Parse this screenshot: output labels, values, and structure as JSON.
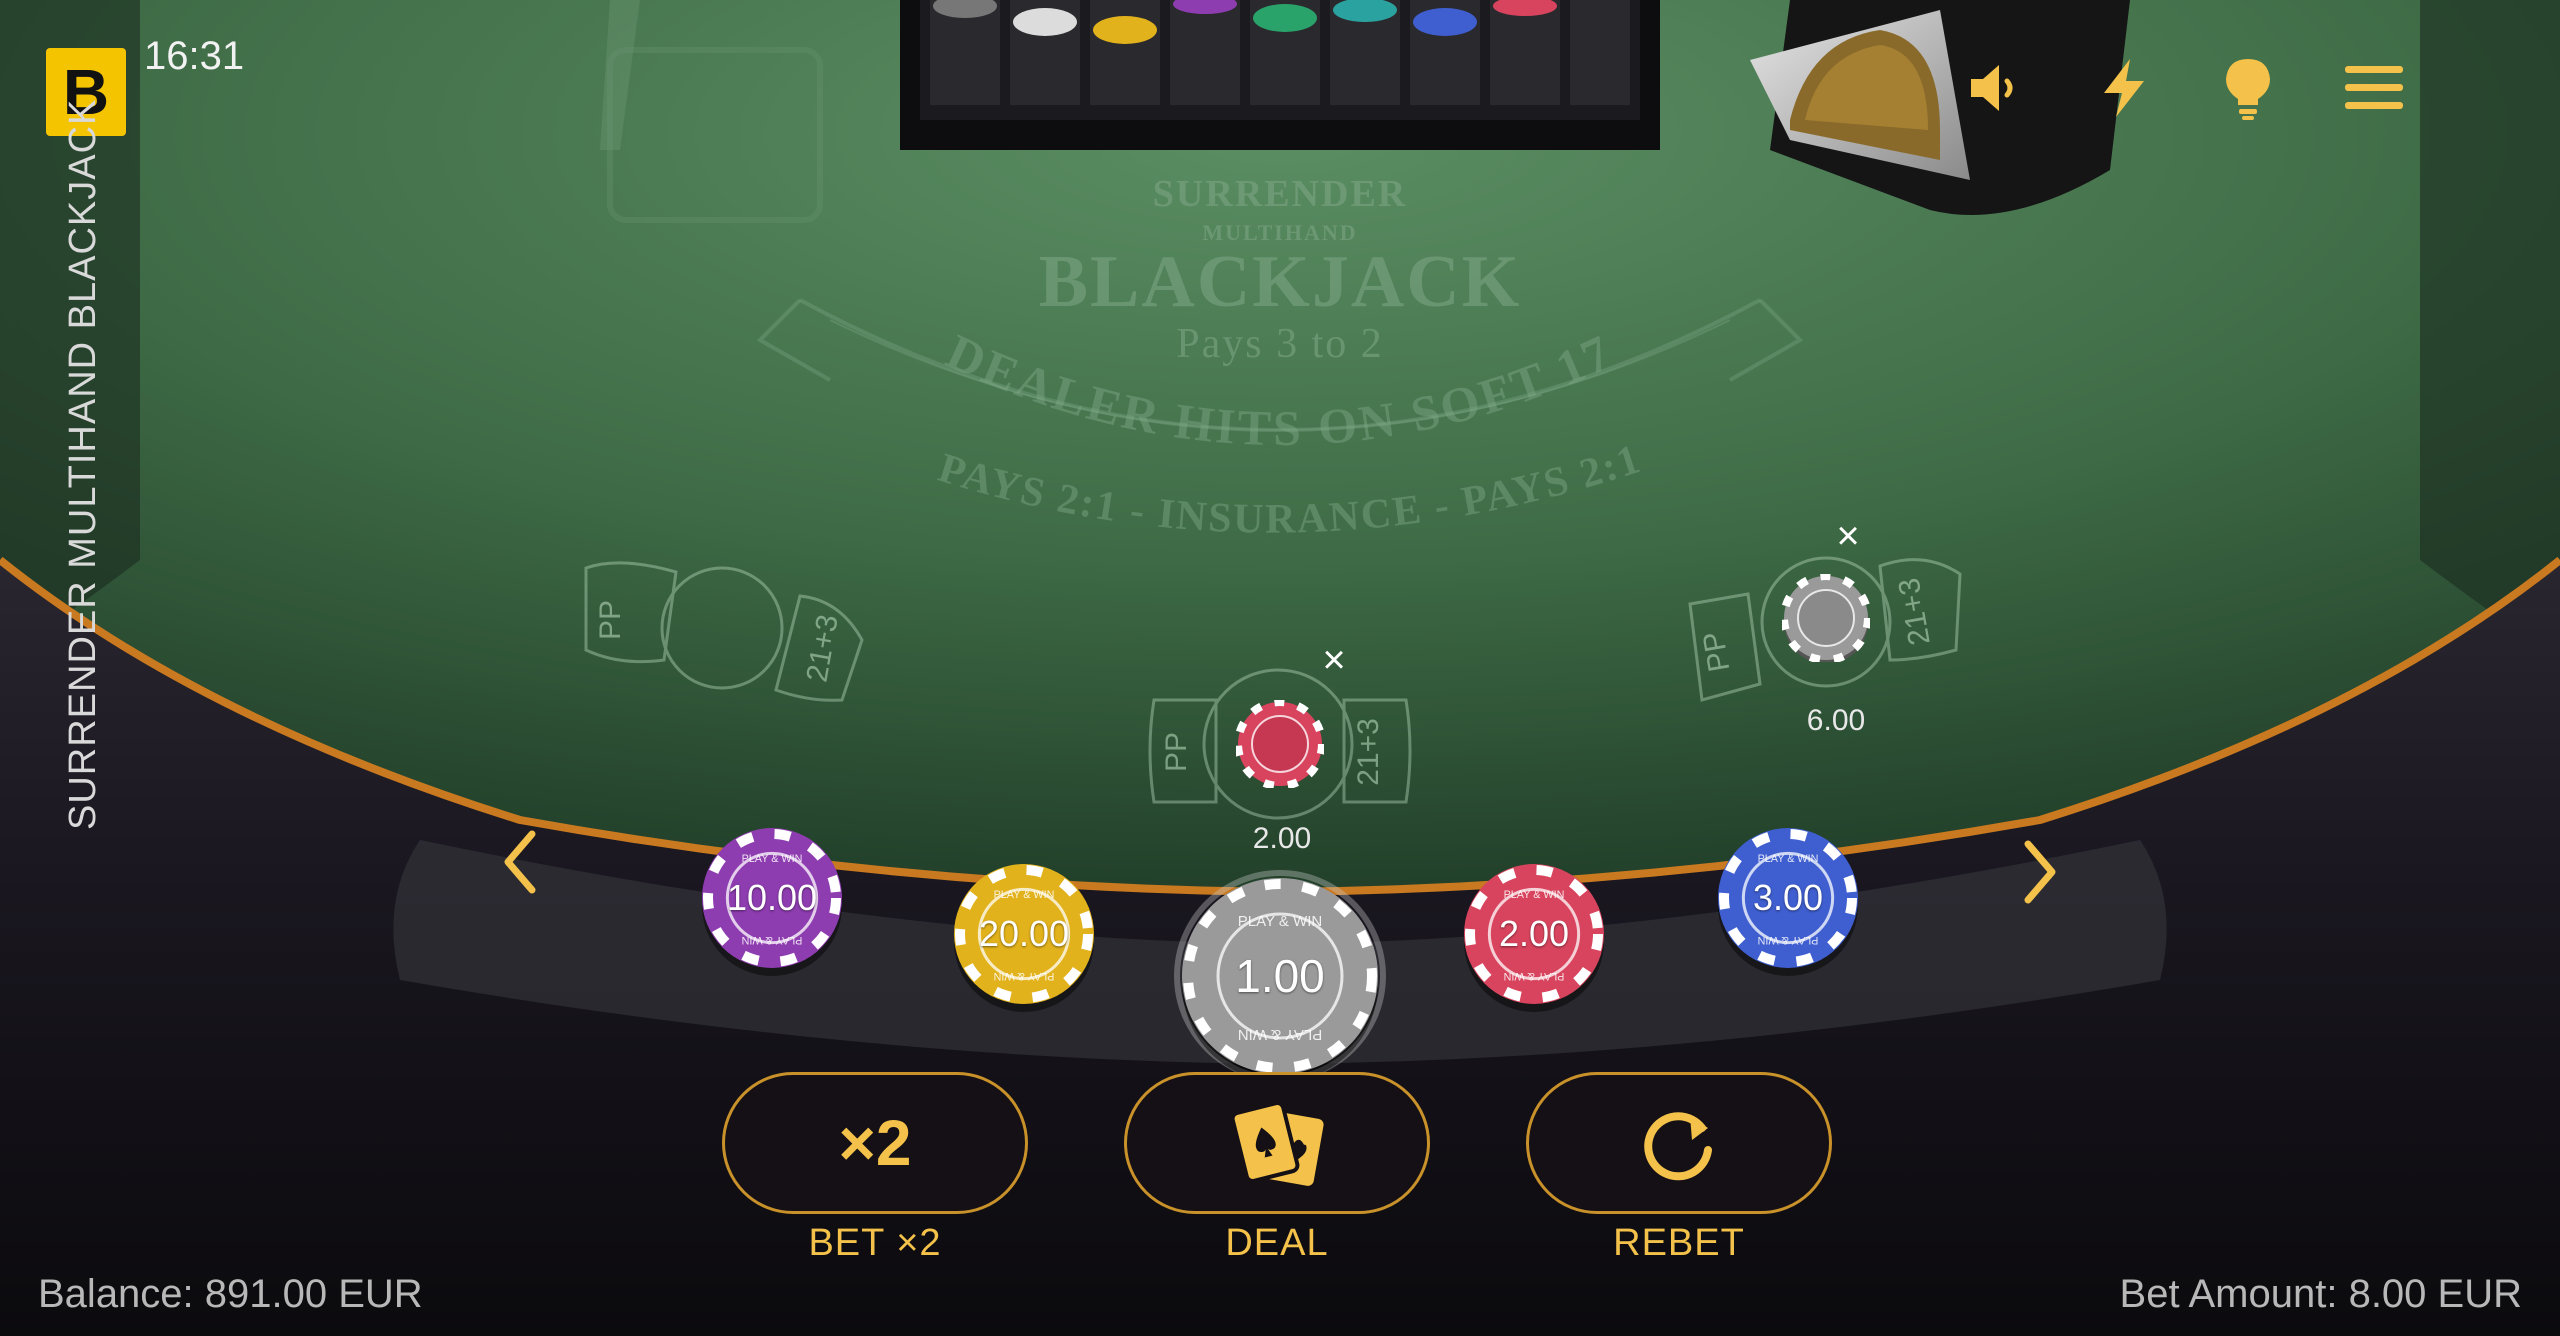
{
  "header": {
    "logo_letter": "B",
    "clock": "16:31",
    "game_title": "SURRENDER MULTIHAND BLACKJACK"
  },
  "table_print": {
    "surrender": "SURRENDER",
    "multihand": "MULTIHAND",
    "blackjack": "BLACKJACK",
    "pays": "Pays 3 to 2",
    "dealer_rule": "DEALER HITS ON SOFT 17",
    "insurance": "PAYS 2:1 - INSURANCE - PAYS 2:1",
    "side_bet_pp": "PP",
    "side_bet_21": "21+3"
  },
  "top_icons": [
    "speaker-icon",
    "lightning-icon",
    "lightbulb-icon",
    "hamburger-menu-icon"
  ],
  "spots": {
    "spot2": {
      "amount": "2.00",
      "remove": "×"
    },
    "spot3": {
      "amount": "6.00",
      "remove": "×"
    }
  },
  "chips": [
    {
      "value": "10.00",
      "color": "#8e3db0"
    },
    {
      "value": "20.00",
      "color": "#e2b21c"
    },
    {
      "value": "1.00",
      "color": "#9a9a9a"
    },
    {
      "value": "2.00",
      "color": "#d8445e"
    },
    {
      "value": "3.00",
      "color": "#3f5fd0"
    }
  ],
  "chip_text": "PLAY & WIN",
  "actions": {
    "bet_x2_icon_text": "×2",
    "bet_x2": "BET ×2",
    "deal": "DEAL",
    "rebet": "REBET"
  },
  "footer": {
    "balance": "Balance: 891.00 EUR",
    "bet_amount": "Bet Amount: 8.00 EUR"
  },
  "colors": {
    "felt": "#47784f",
    "gold": "#f4c24a",
    "rail_trim": "#c9791f"
  }
}
